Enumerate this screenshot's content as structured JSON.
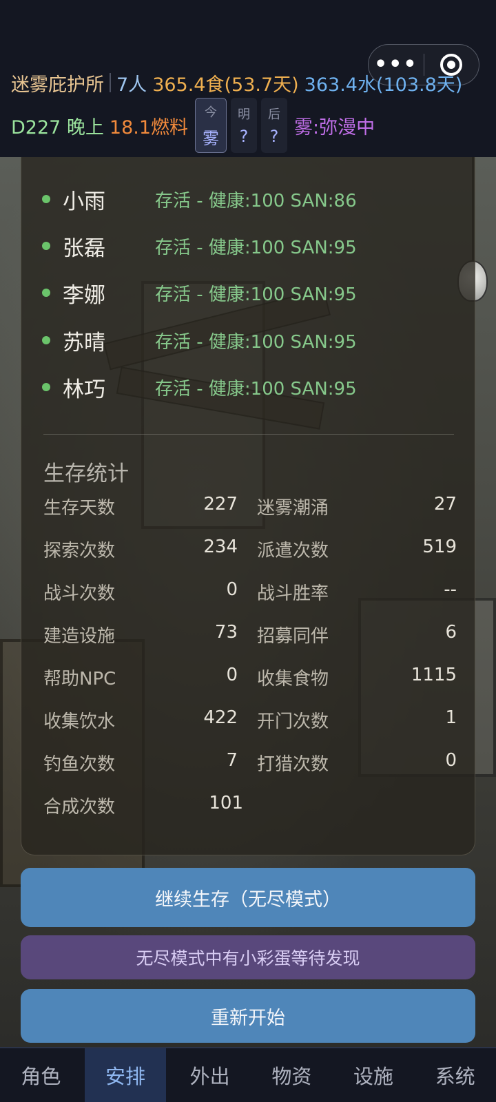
{
  "header": {
    "shelter_name": "迷雾庇护所",
    "people": "7人",
    "food": "365.4食(53.7天)",
    "water": "363.4水(103.8天)",
    "day": "D227",
    "time_of_day": "晚上",
    "fuel": "18.1燃料",
    "fog_forecast": [
      {
        "label": "今",
        "value": "雾"
      },
      {
        "label": "明",
        "value": "?"
      },
      {
        "label": "后",
        "value": "?"
      }
    ],
    "fog_status": "雾:弥漫中",
    "capsule": {
      "more_icon": "more-dots-icon",
      "close_icon": "target-circle-icon"
    }
  },
  "members": [
    {
      "name": "小雨",
      "status": "存活 - 健康:100 SAN:86"
    },
    {
      "name": "张磊",
      "status": "存活 - 健康:100 SAN:95"
    },
    {
      "name": "李娜",
      "status": "存活 - 健康:100 SAN:95"
    },
    {
      "name": "苏晴",
      "status": "存活 - 健康:100 SAN:95"
    },
    {
      "name": "林巧",
      "status": "存活 - 健康:100 SAN:95"
    }
  ],
  "stats_title": "生存统计",
  "stats": [
    {
      "k": "生存天数",
      "v": "227"
    },
    {
      "k": "迷雾潮涌",
      "v": "27"
    },
    {
      "k": "探索次数",
      "v": "234"
    },
    {
      "k": "派遣次数",
      "v": "519"
    },
    {
      "k": "战斗次数",
      "v": "0"
    },
    {
      "k": "战斗胜率",
      "v": "--"
    },
    {
      "k": "建造设施",
      "v": "73"
    },
    {
      "k": "招募同伴",
      "v": "6"
    },
    {
      "k": "帮助NPC",
      "v": "0"
    },
    {
      "k": "收集食物",
      "v": "1115"
    },
    {
      "k": "收集饮水",
      "v": "422"
    },
    {
      "k": "开门次数",
      "v": "1"
    },
    {
      "k": "钓鱼次数",
      "v": "7"
    },
    {
      "k": "打猎次数",
      "v": "0"
    },
    {
      "k": "合成次数",
      "v": "101"
    }
  ],
  "buttons": {
    "continue": "继续生存（无尽模式）",
    "easter_egg": "无尽模式中有小彩蛋等待发现",
    "restart": "重新开始"
  },
  "nav": {
    "tabs": [
      "角色",
      "安排",
      "外出",
      "物资",
      "设施",
      "系统"
    ],
    "active": "安排"
  }
}
